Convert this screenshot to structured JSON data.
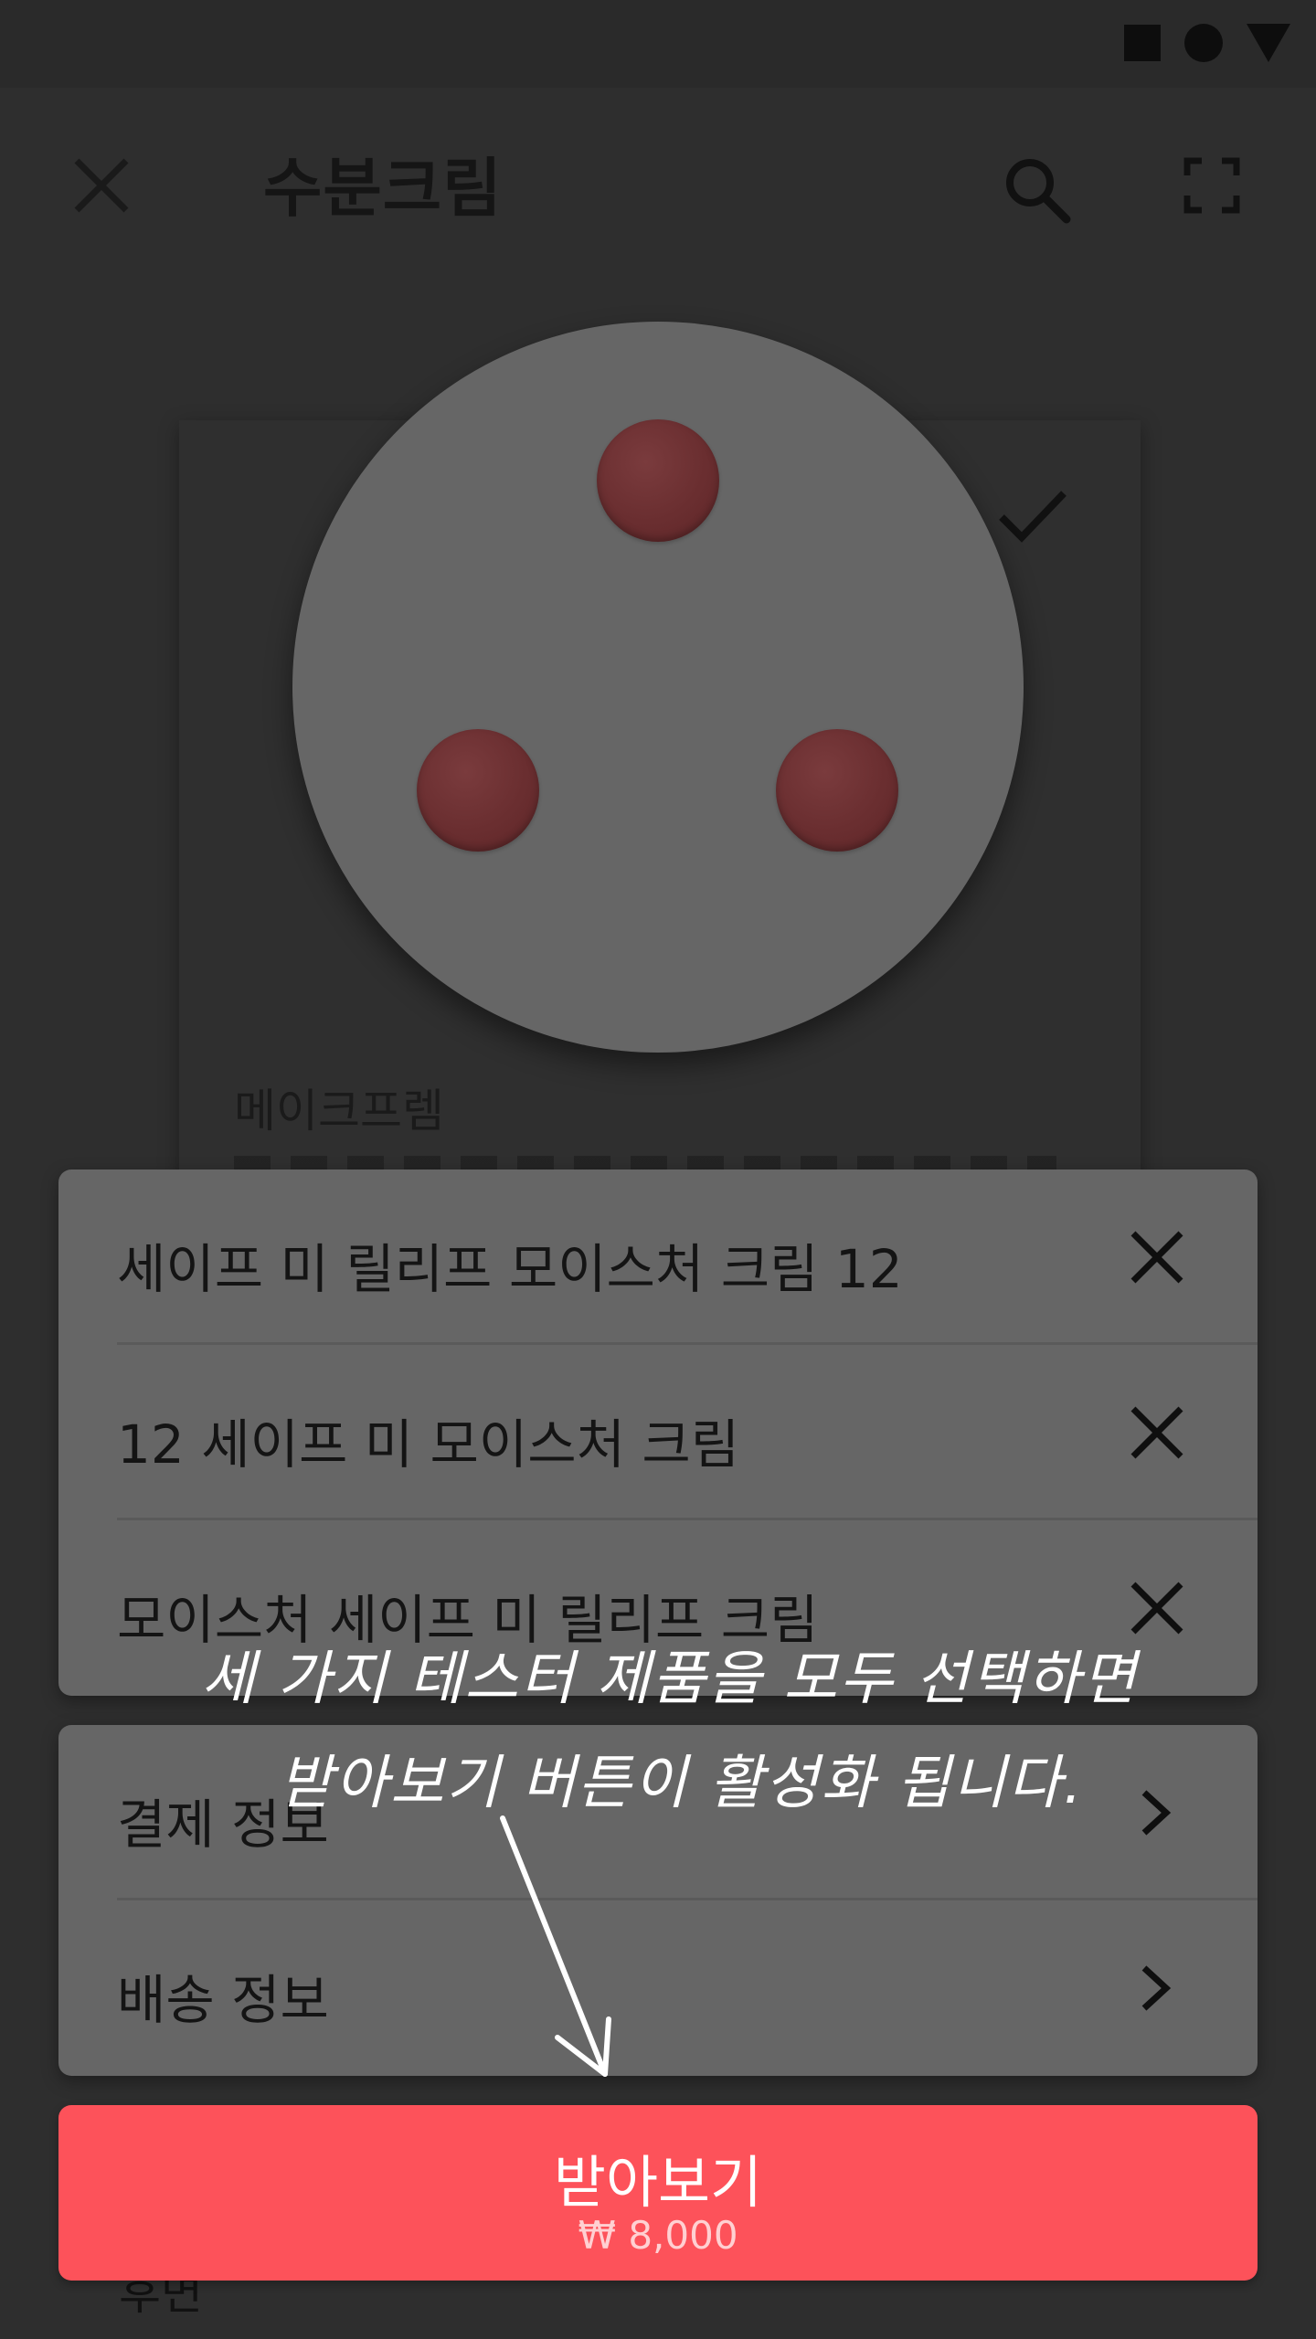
{
  "app_bar": {
    "title": "수분크림",
    "close_icon": "close-icon",
    "search_icon": "search-icon",
    "expand_icon": "expand-icon"
  },
  "card": {
    "brand": "메이크프렘",
    "selected_icon": "check-icon"
  },
  "products": [
    {
      "name": "세이프 미 릴리프 모이스처 크림 12"
    },
    {
      "name": "12 세이프 미 모이스처 크림"
    },
    {
      "name": "모이스처 세이프 미 릴리프 크림"
    }
  ],
  "info_rows": [
    {
      "label": "결제 정보"
    },
    {
      "label": "배송 정보"
    }
  ],
  "cta": {
    "label": "받아보기",
    "price": "₩ 8,000"
  },
  "footer": {
    "peek_text": "후면"
  },
  "annotation": {
    "line1": "세 가지 테스터 제품을 모두 선택하면",
    "line2": "받아보기 버튼이 활성화 됩니다."
  },
  "colors": {
    "accent": "#fd525a",
    "sheet": "#666666",
    "background": "#2e2e2e"
  }
}
